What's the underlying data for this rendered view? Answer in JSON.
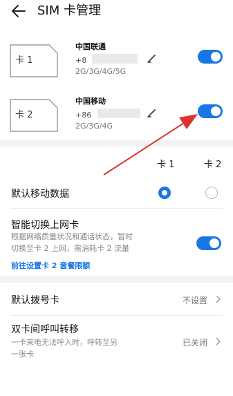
{
  "header": {
    "title": "SIM 卡管理"
  },
  "sims": [
    {
      "card_label": "卡 1",
      "carrier": "中国联通",
      "number_prefix": "+8",
      "network_types": "2G/3G/4G/5G",
      "enabled": true
    },
    {
      "card_label": "卡 2",
      "carrier": "中国移动",
      "number_prefix": "+86",
      "network_types": "2G/3G/4G",
      "enabled": true
    }
  ],
  "columns": {
    "card1": "卡 1",
    "card2": "卡 2"
  },
  "default_data": {
    "label": "默认移动数据",
    "selected": "卡 1"
  },
  "smart_switch": {
    "label": "智能切换上网卡",
    "description_line1": "根据网络质量状况和通话状态，暂时",
    "description_line2": "切换至卡 2 上网，需消耗卡 2 流量",
    "link": "前往设置卡 2 套餐限额",
    "enabled": true
  },
  "default_dial": {
    "label": "默认拨号卡",
    "value": "不设置"
  },
  "call_forward": {
    "label": "双卡间呼叫转移",
    "description_line1": "一卡来电无法呼入时，呼转至另",
    "description_line2": "一张卡",
    "value": "已关闭"
  },
  "colors": {
    "accent": "#1976e6",
    "annotation_arrow": "#e03030"
  },
  "icons": {
    "back": "back-arrow-icon",
    "edit": "edit-pencil-icon",
    "chevron": "chevron-right-icon"
  }
}
